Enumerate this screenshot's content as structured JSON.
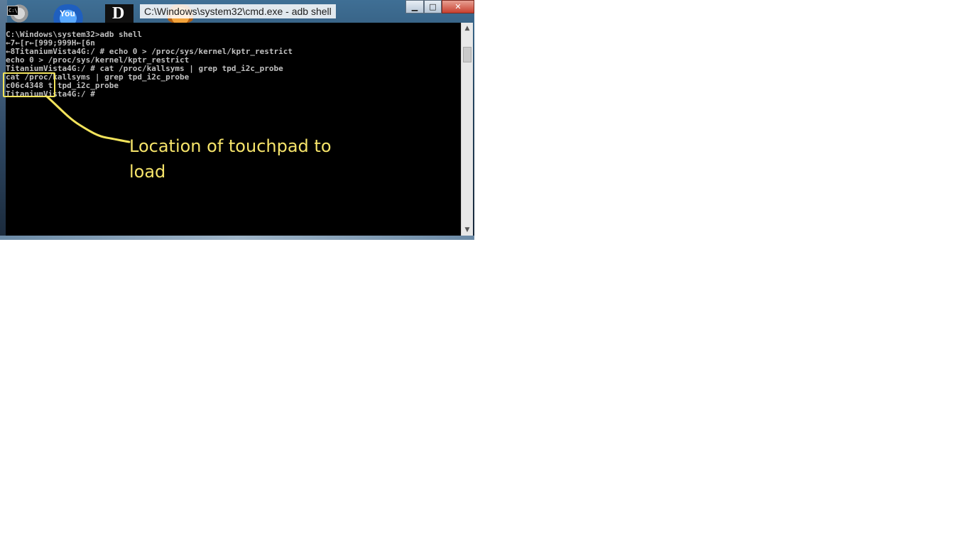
{
  "window": {
    "title": "C:\\Windows\\system32\\cmd.exe - adb  shell",
    "icon_label": "C:\\",
    "buttons": {
      "minimize": "▁",
      "maximize": "□",
      "close": "✕"
    }
  },
  "desktop": {
    "icons": [
      {
        "name": "gear-icon"
      },
      {
        "name": "youtube-icon",
        "label": "You"
      },
      {
        "name": "d-app-icon",
        "label": "D"
      },
      {
        "name": "orange-app-icon"
      }
    ]
  },
  "console": {
    "lines": [
      "C:\\Windows\\system32>adb shell",
      "←7←[r←[999;999H←[6n",
      "←8TitaniumVista4G:/ # echo 0 > /proc/sys/kernel/kptr_restrict",
      "echo 0 > /proc/sys/kernel/kptr_restrict",
      "TitaniumVista4G:/ # cat /proc/kallsyms | grep tpd_i2c_probe",
      "cat /proc/kallsyms | grep tpd_i2c_probe",
      "c06c4348 t tpd_i2c_probe",
      "TitaniumVista4G:/ #"
    ]
  },
  "annotation": {
    "text": "Location of touchpad to load",
    "color": "#f2e35b"
  },
  "colors": {
    "console_bg": "#000000",
    "console_fg": "#c0c0c0",
    "close_button": "#c7402f"
  }
}
